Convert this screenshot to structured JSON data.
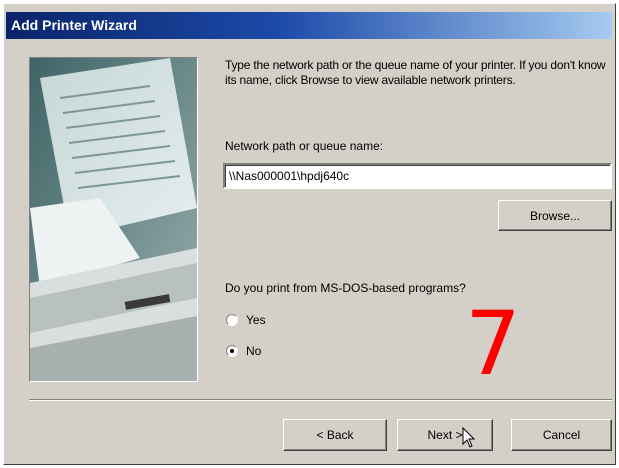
{
  "window": {
    "title": "Add Printer Wizard"
  },
  "instructions": "Type the network path or the queue name of your printer. If you don't know its name, click Browse to view available network printers.",
  "path_field": {
    "label": "Network path or queue name:",
    "value": "\\\\Nas000001\\hpdj640c"
  },
  "buttons": {
    "browse": "Browse...",
    "back": "< Back",
    "next": "Next >",
    "cancel": "Cancel"
  },
  "msdos": {
    "question": "Do you print from MS-DOS-based programs?",
    "options": [
      {
        "label": "Yes",
        "selected": false
      },
      {
        "label": "No",
        "selected": true
      }
    ]
  },
  "overlay": {
    "step_number": "7",
    "color": "#ff0000"
  },
  "colors": {
    "dialog": "#d4d0c8",
    "title_start": "#0a246a",
    "title_end": "#a6caf0"
  }
}
